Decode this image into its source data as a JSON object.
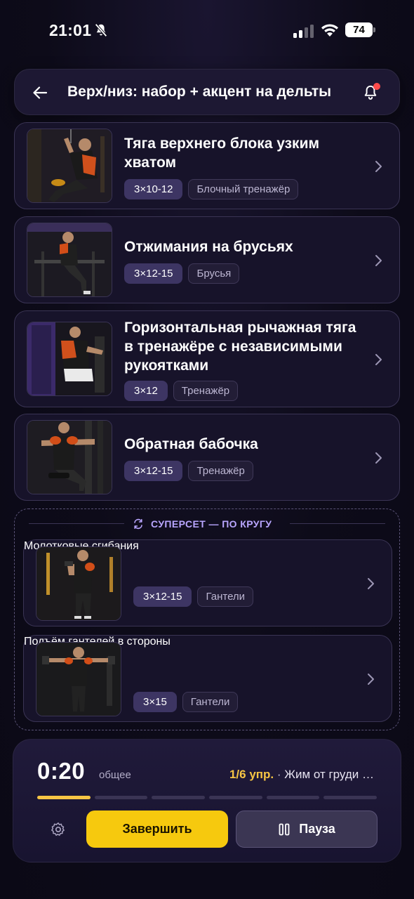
{
  "status_bar": {
    "time": "21:01",
    "battery": "74"
  },
  "header": {
    "title": "Верх/низ: набор + акцент на дельты"
  },
  "exercises": [
    {
      "title": "Тяга верхнего блока узким хватом",
      "sets": "3×10-12",
      "equipment": "Блочный тренажёр"
    },
    {
      "title": "Отжимания на брусьях",
      "sets": "3×12-15",
      "equipment": "Брусья"
    },
    {
      "title": "Горизонтальная рычажная тяга в тренажёре с независимыми рукоятками",
      "sets": "3×12",
      "equipment": "Тренажёр"
    },
    {
      "title": "Обратная бабочка",
      "sets": "3×12-15",
      "equipment": "Тренажёр"
    }
  ],
  "superset": {
    "label": "СУПЕРСЕТ — ПО КРУГУ",
    "items": [
      {
        "title": "Молотковые сгибания",
        "sets": "3×12-15",
        "equipment": "Гантели"
      },
      {
        "title": "Подъём гантелей в стороны",
        "sets": "3×15",
        "equipment": "Гантели"
      }
    ]
  },
  "session": {
    "timer": "0:20",
    "timer_label": "общее",
    "progress_count": "1/6 упр.",
    "progress_separator": " · ",
    "current_exercise": "Жим от груди …",
    "segments_total": 6,
    "segments_done": 1,
    "finish_label": "Завершить",
    "pause_label": "Пауза"
  },
  "colors": {
    "accent_yellow": "#f6c90e",
    "superset_label": "#b9a6ff",
    "background": "#0d0b19"
  }
}
